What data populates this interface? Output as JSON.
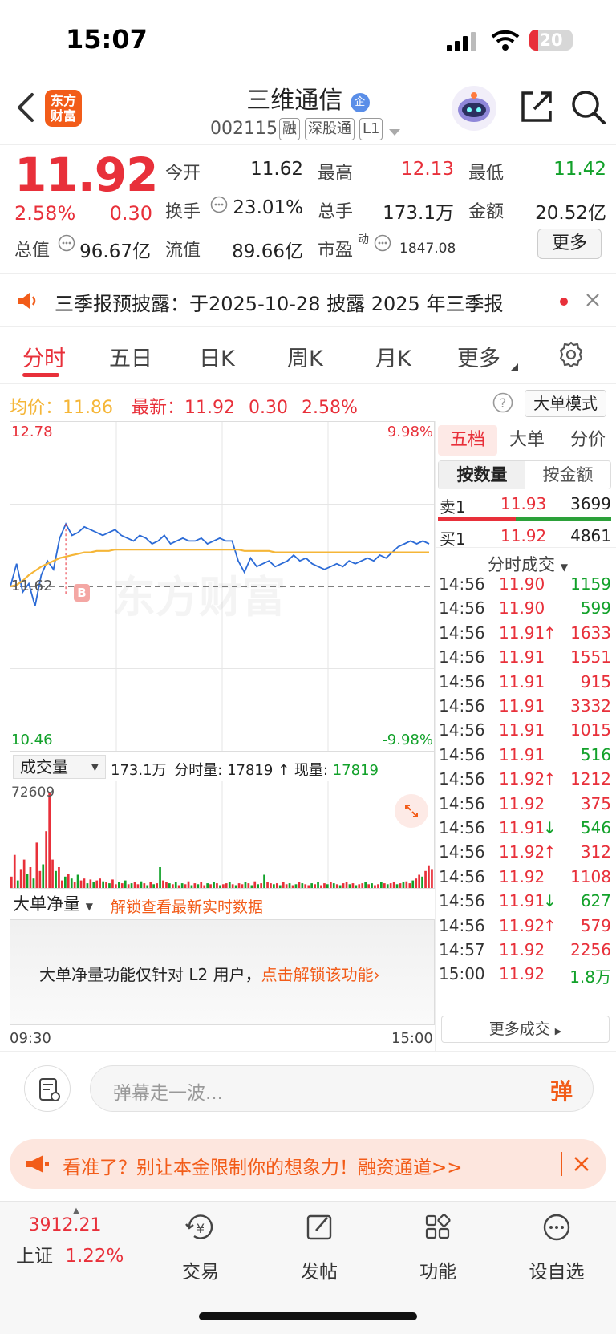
{
  "status": {
    "time": "15:07",
    "battery": "20",
    "battery_level": 0.2
  },
  "header": {
    "logo_line1": "东方",
    "logo_line2": "财富",
    "name": "三维通信",
    "name_badge": "企",
    "code": "002115",
    "tags": [
      "融",
      "深股通",
      "L1"
    ]
  },
  "quote": {
    "price": "11.92",
    "change_pct": "2.58%",
    "change": "0.30",
    "open_label": "今开",
    "open": "11.62",
    "high_label": "最高",
    "high": "12.13",
    "low_label": "最低",
    "low": "11.42",
    "turnover_label": "换手",
    "turnover": "23.01%",
    "volume_label": "总手",
    "volume": "173.1万",
    "amount_label": "金额",
    "amount": "20.52亿",
    "mktcap_label": "总值",
    "mktcap": "96.67亿",
    "float_label": "流值",
    "float": "89.66亿",
    "pe_label": "市盈",
    "pe_sup": "动",
    "pe": "1847.08",
    "more": "更多"
  },
  "notice": {
    "text": "三季报预披露：于2025-10-28 披露 2025 年三季报"
  },
  "tabs": [
    "分时",
    "五日",
    "日K",
    "周K",
    "月K",
    "更多"
  ],
  "avg": {
    "avg_label": "均价：",
    "avg_value": "11.86",
    "latest_label": "最新：",
    "latest_value": "11.92",
    "latest_change": "0.30",
    "latest_pct": "2.58%",
    "mode_button": "大单模式"
  },
  "chart_data": {
    "type": "line",
    "title": "",
    "x_start": "09:30",
    "x_end": "15:00",
    "y_max": "12.78",
    "y_min": "10.46",
    "y_max_pct": "9.98%",
    "y_min_pct": "-9.98%",
    "prev_close": "11.62",
    "ylim": [
      10.46,
      12.78
    ],
    "series": [
      {
        "values": [
          11.62,
          11.78,
          11.58,
          11.64,
          11.48,
          11.7,
          11.8,
          11.74,
          11.96,
          12.06,
          11.98,
          12.0,
          12.04,
          12.02,
          12.0,
          11.98,
          12.0,
          12.02,
          11.98,
          11.96,
          11.94,
          11.98,
          11.96,
          11.92,
          11.94,
          11.98,
          11.92,
          11.94,
          11.96,
          11.94,
          11.94,
          11.96,
          11.92,
          11.94,
          11.96,
          11.94,
          11.94,
          11.8,
          11.72,
          11.82,
          11.76,
          11.78,
          11.8,
          11.76,
          11.78,
          11.8,
          11.84,
          11.8,
          11.82,
          11.78,
          11.76,
          11.74,
          11.76,
          11.78,
          11.76,
          11.8,
          11.78,
          11.8,
          11.82,
          11.8,
          11.84,
          11.82,
          11.86,
          11.9,
          11.92,
          11.94,
          11.92,
          11.94,
          11.92
        ]
      },
      {
        "values": [
          11.62,
          11.63,
          11.66,
          11.7,
          11.73,
          11.76,
          11.78,
          11.8,
          11.82,
          11.83,
          11.84,
          11.85,
          11.86,
          11.86,
          11.87,
          11.87,
          11.87,
          11.88,
          11.88,
          11.88,
          11.88,
          11.88,
          11.88,
          11.88,
          11.88,
          11.88,
          11.88,
          11.88,
          11.88,
          11.88,
          11.88,
          11.88,
          11.88,
          11.88,
          11.88,
          11.88,
          11.88,
          11.88,
          11.87,
          11.87,
          11.87,
          11.87,
          11.87,
          11.86,
          11.86,
          11.86,
          11.86,
          11.86,
          11.86,
          11.86,
          11.86,
          11.86,
          11.86,
          11.86,
          11.86,
          11.86,
          11.86,
          11.86,
          11.86,
          11.86,
          11.86,
          11.86,
          11.86,
          11.86,
          11.86,
          11.86,
          11.86,
          11.86,
          11.86
        ]
      }
    ]
  },
  "volume": {
    "label": "成交量",
    "total": "173.1万",
    "fenshi_label": "分时量:",
    "fenshi": "17819",
    "current_label": "现量:",
    "current": "17819",
    "max": "72609",
    "bars": [
      12,
      35,
      8,
      20,
      30,
      15,
      22,
      10,
      48,
      18,
      25,
      60,
      100,
      30,
      18,
      22,
      8,
      12,
      15,
      10,
      6,
      14,
      8,
      10,
      5,
      9,
      6,
      8,
      10,
      7,
      6,
      5,
      9,
      4,
      6,
      5,
      8,
      4,
      5,
      6,
      4,
      7,
      5,
      3,
      6,
      4,
      5,
      22,
      8,
      6,
      5,
      4,
      6,
      3,
      5,
      4,
      7,
      3,
      5,
      4,
      6,
      3,
      5,
      4,
      6,
      5,
      3,
      4,
      5,
      6,
      4,
      3,
      5,
      4,
      6,
      5,
      3,
      7,
      4,
      5,
      14,
      6,
      5,
      4,
      5,
      3,
      6,
      4,
      5,
      3,
      4,
      6,
      5,
      4,
      3,
      5,
      4,
      6,
      3,
      5,
      4,
      6,
      5,
      4,
      3,
      5,
      6,
      4,
      5,
      3,
      4,
      5,
      6,
      4,
      5,
      3,
      4,
      6,
      5,
      4,
      5,
      6,
      4,
      5,
      6,
      7,
      5,
      8,
      10,
      14,
      12,
      18,
      24,
      20
    ],
    "bar_up": [
      1,
      1,
      0,
      1,
      1,
      0,
      1,
      0,
      1,
      1,
      0,
      1,
      1,
      1,
      0,
      1,
      1,
      0,
      1,
      0,
      1,
      0,
      1,
      1,
      0,
      1,
      0,
      1,
      1,
      0,
      1,
      0,
      1,
      1,
      0,
      1,
      0,
      1,
      0,
      1,
      1,
      0,
      1,
      0,
      1,
      0,
      1,
      0,
      1,
      1,
      0,
      1,
      0,
      1,
      0,
      1,
      1,
      0,
      1,
      0,
      1,
      1,
      0,
      1,
      0,
      1,
      0,
      1,
      1,
      0,
      1,
      0,
      1,
      1,
      0,
      1,
      0,
      1,
      0,
      1,
      0,
      1,
      1,
      0,
      1,
      0,
      1,
      1,
      0,
      1,
      0,
      1,
      0,
      1,
      1,
      0,
      1,
      0,
      1,
      1,
      0,
      1,
      0,
      1,
      0,
      1,
      1,
      0,
      1,
      0,
      1,
      1,
      0,
      1,
      0,
      1,
      1,
      0,
      1,
      0,
      1,
      1,
      0,
      1,
      0,
      1,
      1,
      0,
      1,
      1,
      0,
      1,
      1,
      1,
      0,
      1
    ]
  },
  "big_order": {
    "label": "大单净量",
    "unlock_link": "解锁查看最新实时数据",
    "message": "大单净量功能仅针对 L2 用户，",
    "message_link": "点击解锁该功能"
  },
  "time_axis": {
    "start": "09:30",
    "end": "15:00"
  },
  "order_book": {
    "tabs": [
      "五档",
      "大单",
      "分价"
    ],
    "sub_tabs": [
      "按数量",
      "按金额"
    ],
    "sell_label": "卖1",
    "sell_price": "11.93",
    "sell_vol": "3699",
    "buy_label": "买1",
    "buy_price": "11.92",
    "buy_vol": "4861",
    "sell_ratio": 0.45,
    "ticks_title": "分时成交",
    "ticks": [
      {
        "t": "14:56",
        "p": "11.90",
        "a": "",
        "v": "1159",
        "c": "green"
      },
      {
        "t": "14:56",
        "p": "11.90",
        "a": "",
        "v": "599",
        "c": "green"
      },
      {
        "t": "14:56",
        "p": "11.91",
        "a": "↑",
        "v": "1633",
        "c": "red"
      },
      {
        "t": "14:56",
        "p": "11.91",
        "a": "",
        "v": "1551",
        "c": "red"
      },
      {
        "t": "14:56",
        "p": "11.91",
        "a": "",
        "v": "915",
        "c": "red"
      },
      {
        "t": "14:56",
        "p": "11.91",
        "a": "",
        "v": "3332",
        "c": "red"
      },
      {
        "t": "14:56",
        "p": "11.91",
        "a": "",
        "v": "1015",
        "c": "red"
      },
      {
        "t": "14:56",
        "p": "11.91",
        "a": "",
        "v": "516",
        "c": "green"
      },
      {
        "t": "14:56",
        "p": "11.92",
        "a": "↑",
        "v": "1212",
        "c": "red"
      },
      {
        "t": "14:56",
        "p": "11.92",
        "a": "",
        "v": "375",
        "c": "red"
      },
      {
        "t": "14:56",
        "p": "11.91",
        "a": "↓",
        "v": "546",
        "c": "green"
      },
      {
        "t": "14:56",
        "p": "11.92",
        "a": "↑",
        "v": "312",
        "c": "red"
      },
      {
        "t": "14:56",
        "p": "11.92",
        "a": "",
        "v": "1108",
        "c": "red"
      },
      {
        "t": "14:56",
        "p": "11.91",
        "a": "↓",
        "v": "627",
        "c": "green"
      },
      {
        "t": "14:56",
        "p": "11.92",
        "a": "↑",
        "v": "579",
        "c": "red"
      },
      {
        "t": "14:57",
        "p": "11.92",
        "a": "",
        "v": "2256",
        "c": "red"
      },
      {
        "t": "15:00",
        "p": "11.92",
        "a": "",
        "v": "1.8万",
        "c": "green"
      }
    ],
    "more_ticks": "更多成交"
  },
  "barrage": {
    "placeholder": "弹幕走一波...",
    "button": "弹"
  },
  "banner": {
    "text": "看准了？别让本金限制你的想象力！融资通道>>"
  },
  "bottom_nav": {
    "index_value": "3912.21",
    "index_name": "上证",
    "index_pct": "1.22%",
    "items": [
      "交易",
      "发帖",
      "功能",
      "设自选"
    ]
  },
  "colors": {
    "up": "#e8303a",
    "down": "#12a12a",
    "avg": "#f5b638",
    "price_line": "#2c6bd6",
    "brand": "#f25c19"
  },
  "watermark": "东方财富"
}
